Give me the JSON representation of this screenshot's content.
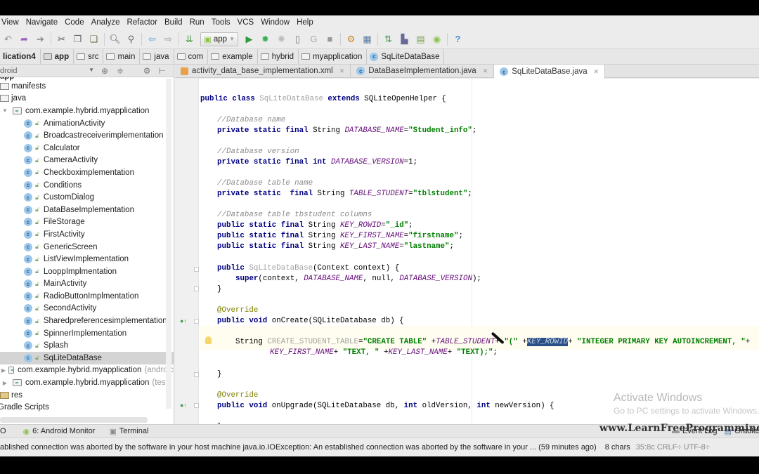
{
  "menu": [
    "View",
    "Navigate",
    "Code",
    "Analyze",
    "Refactor",
    "Build",
    "Run",
    "Tools",
    "VCS",
    "Window",
    "Help"
  ],
  "toolbar": {
    "run_config": "app",
    "icons": [
      "undo-icon",
      "redo-icon",
      "cut-icon",
      "copy-icon",
      "paste-icon",
      "find-icon",
      "replace-icon",
      "back-icon",
      "forward-icon",
      "make-icon",
      "run-icon",
      "debug-icon",
      "attach-debugger-icon",
      "device-icon",
      "apply-changes-icon",
      "stop-icon",
      "project-structure-icon",
      "sdk-manager-icon",
      "sync-gradle-icon",
      "avd-manager-icon",
      "device-monitor-icon",
      "android-icon",
      "help-icon"
    ]
  },
  "breadcrumb": [
    "lication4",
    "app",
    "src",
    "main",
    "java",
    "com",
    "example",
    "hybrid",
    "myapplication",
    "SqLiteDataBase"
  ],
  "sidebar": {
    "view_selector": "droid",
    "root": "app",
    "items": [
      {
        "label": "manifests",
        "type": "dir",
        "indent": 0
      },
      {
        "label": "java",
        "type": "dir",
        "indent": 0
      },
      {
        "label": "com.example.hybrid.myapplication",
        "type": "package",
        "indent": 1,
        "expanded": true
      },
      {
        "label": "AnimationActivity",
        "type": "class"
      },
      {
        "label": "Broadcastreceiverimplementation",
        "type": "class"
      },
      {
        "label": "Calculator",
        "type": "class"
      },
      {
        "label": "CameraActivity",
        "type": "class"
      },
      {
        "label": "Checkboximplementation",
        "type": "class"
      },
      {
        "label": "Conditions",
        "type": "class"
      },
      {
        "label": "CustomDialog",
        "type": "class"
      },
      {
        "label": "DataBaseImplementation",
        "type": "class"
      },
      {
        "label": "FileStorage",
        "type": "class"
      },
      {
        "label": "FirstActivity",
        "type": "class"
      },
      {
        "label": "GenericScreen",
        "type": "class"
      },
      {
        "label": "ListViewImplementation",
        "type": "class"
      },
      {
        "label": "LooppImplmentation",
        "type": "class"
      },
      {
        "label": "MainActivity",
        "type": "class"
      },
      {
        "label": "RadioButtonImplmentation",
        "type": "class"
      },
      {
        "label": "SecondActivity",
        "type": "class"
      },
      {
        "label": "Sharedpreferencesimplementation",
        "type": "class"
      },
      {
        "label": "SpinnerImplementation",
        "type": "class"
      },
      {
        "label": "Splash",
        "type": "class"
      },
      {
        "label": "SqLiteDataBase",
        "type": "class",
        "selected": true
      },
      {
        "label": "com.example.hybrid.myapplication",
        "suffix": "(androic",
        "type": "package",
        "indent": 1
      },
      {
        "label": "com.example.hybrid.myapplication",
        "suffix": "(test)",
        "type": "package",
        "indent": 1
      },
      {
        "label": "res",
        "type": "res",
        "indent": 0
      },
      {
        "label": "Gradle Scripts",
        "type": "root",
        "indent": -1
      }
    ]
  },
  "tabs": [
    {
      "label": "activity_data_base_implementation.xml",
      "icon": "xml-file-icon",
      "active": false
    },
    {
      "label": "DataBaseImplementation.java",
      "icon": "class-icon",
      "active": false
    },
    {
      "label": "SqLiteDataBase.java",
      "icon": "class-icon",
      "active": true
    }
  ],
  "code": {
    "l1": [
      "public class ",
      "SqLiteDataBase",
      " extends ",
      "SQLiteOpenHelper {"
    ],
    "c1": "//Database name",
    "l2": [
      "private static final ",
      "String ",
      "DATABASE_NAME",
      "=",
      "\"Student_info\"",
      ";"
    ],
    "c2": "//Database version",
    "l3": [
      "private static final int ",
      "DATABASE_VERSION",
      "=1;"
    ],
    "c3": "//Database table name",
    "l4": [
      "private static  final ",
      "String ",
      "TABLE_STUDENT",
      "=",
      "\"tblstudent\"",
      ";"
    ],
    "c4": "//Database table tbstudent columns",
    "l5": [
      "public static final ",
      "String ",
      "KEY_ROWID",
      "=",
      "\"_id\"",
      ";"
    ],
    "l6": [
      "public static final ",
      "String ",
      "KEY_FIRST_NAME",
      "=",
      "\"firstname\"",
      ";"
    ],
    "l7": [
      "public static final ",
      "String ",
      "KEY_LAST_NAME",
      "=",
      "\"lastname\"",
      ";"
    ],
    "l8": [
      "public ",
      "SqLiteDataBase",
      "(Context context) {"
    ],
    "l9": [
      "super",
      "(context, ",
      "DATABASE_NAME",
      ", null, ",
      "DATABASE_VERSION",
      ");"
    ],
    "l10": "}",
    "an1": "@Override",
    "l11": [
      "public void ",
      "onCreate(SQLiteDatabase db) {"
    ],
    "l12": [
      "String ",
      "CREATE_STUDENT_TABLE",
      "=",
      "\"CREATE TABLE\"",
      " +",
      "TABLE_STUDENT",
      "+ ",
      "\"(\"",
      " +",
      "KEY_ROWID",
      "+ ",
      "\"INTEGER PRIMARY KEY AUTOINCREMENT, \"",
      "+"
    ],
    "l13": [
      "KEY_FIRST_NAME",
      "+ ",
      "\"TEXT, \"",
      " +",
      "KEY_LAST_NAME",
      "+ ",
      "\"TEXT);\"",
      ";"
    ],
    "l14": "}",
    "an2": "@Override",
    "l15": [
      "public void ",
      "onUpgrade(SQLiteDatabase db, ",
      "int ",
      "oldVersion, ",
      "int ",
      "newVersion) {"
    ],
    "l16": "}",
    "l17": "}"
  },
  "tool_windows": {
    "left": [
      "O",
      "6: Android Monitor",
      "Terminal"
    ],
    "right": [
      "Event Log",
      "Gradle"
    ]
  },
  "status": {
    "message": "ablished connection was aborted by the software in your host machine java.io.IOException: An established connection was aborted by the software in your ... (59 minutes ago)",
    "chars": "8 chars",
    "pos": "35:8c   CRLF÷   UTF-8÷"
  },
  "overlay": {
    "activate_title": "Activate Windows",
    "activate_sub": "Go to PC settings to activate Windows.",
    "watermark": "www.LearnFreeProgramming.com"
  }
}
